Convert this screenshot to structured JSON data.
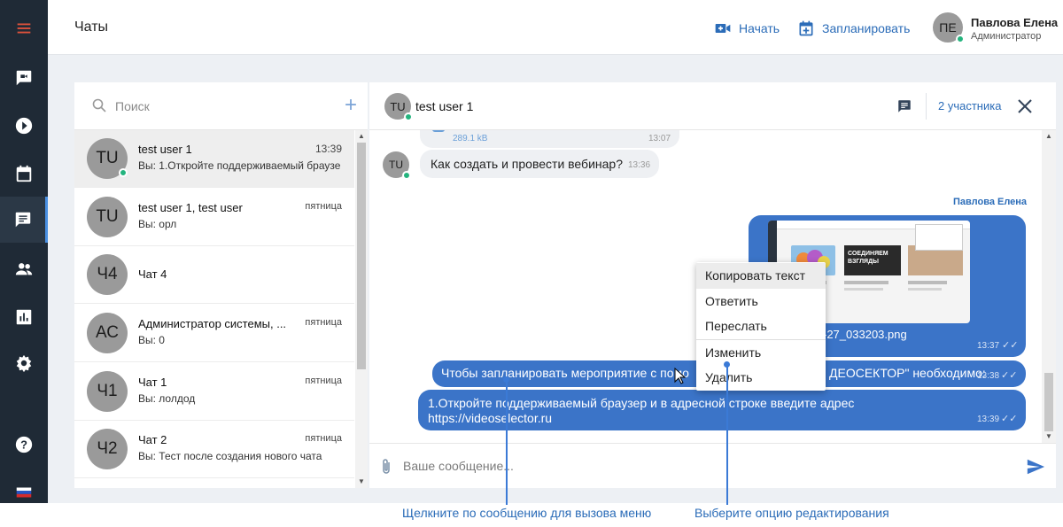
{
  "header": {
    "title": "Чаты",
    "start_label": "Начать",
    "schedule_label": "Запланировать",
    "user_initials": "ПЕ",
    "user_name": "Павлова Елена",
    "user_role": "Администратор"
  },
  "nav": {
    "items": [
      "menu-icon",
      "video-chat-icon",
      "play-icon",
      "calendar-icon",
      "chat-icon",
      "people-icon",
      "stats-icon",
      "settings-icon",
      "help-icon",
      "flag-ru-icon"
    ],
    "active": "chat-icon"
  },
  "chat_list": {
    "search_placeholder": "Поиск",
    "add_label": "+",
    "items": [
      {
        "initials": "TU",
        "name": "test user 1",
        "time": "13:39",
        "preview": "Вы: 1.Откройте поддерживаемый браузе",
        "online": true,
        "selected": true
      },
      {
        "initials": "TU",
        "name": "test user 1, test user",
        "time": "пятница",
        "preview": "Вы: орл",
        "online": false
      },
      {
        "initials": "Ч4",
        "name": "Чат 4",
        "time": "",
        "preview": "",
        "online": false
      },
      {
        "initials": "АС",
        "name": "Администратор системы, ...",
        "time": "пятница",
        "preview": "Вы: 0",
        "online": false
      },
      {
        "initials": "Ч1",
        "name": "Чат 1",
        "time": "пятница",
        "preview": "Вы: лолдод",
        "online": false
      },
      {
        "initials": "Ч2",
        "name": "Чат 2",
        "time": "пятница",
        "preview": "Вы: Тест после создания нового чата",
        "online": false
      }
    ]
  },
  "conversation": {
    "initials": "TU",
    "title": "test user 1",
    "participants": "2 участника",
    "messages": {
      "file_size": "289.1 kB",
      "file_time": "13:07",
      "incoming_text": "Как создать и провести вебинар?",
      "incoming_time": "13:36",
      "sender": "Павлова Елена",
      "image_filename": "-27_033203.png",
      "image_time": "13:37",
      "image_banner": "СОЕДИНЯЕМ ВЗГЛЯДЫ",
      "msg2_text_left": "Чтобы запланировать мероприятие с помо",
      "msg2_text_right": "ДЕОСЕКТОР\" необходимо:",
      "msg2_time": "13:38",
      "msg3_line1": "1.Откройте поддерживаемый браузер и в адресной строке введите адрес",
      "msg3_line2": "https://videoselector.ru",
      "msg3_time": "13:39"
    },
    "compose_placeholder": "Ваше сообщение..."
  },
  "context_menu": {
    "items": [
      "Копировать текст",
      "Ответить",
      "Переслать",
      "Изменить",
      "Удалить"
    ],
    "highlighted": "Копировать текст"
  },
  "annotations": {
    "left": "Щелкните по сообщению для вызова меню",
    "right": "Выберите опцию редактирования"
  },
  "colors": {
    "accent": "#2b6cb8",
    "outgoing_bubble": "#3b74c8",
    "nav_bg": "#1f2a36",
    "online": "#24b47e",
    "menu_red": "#e0523c"
  }
}
